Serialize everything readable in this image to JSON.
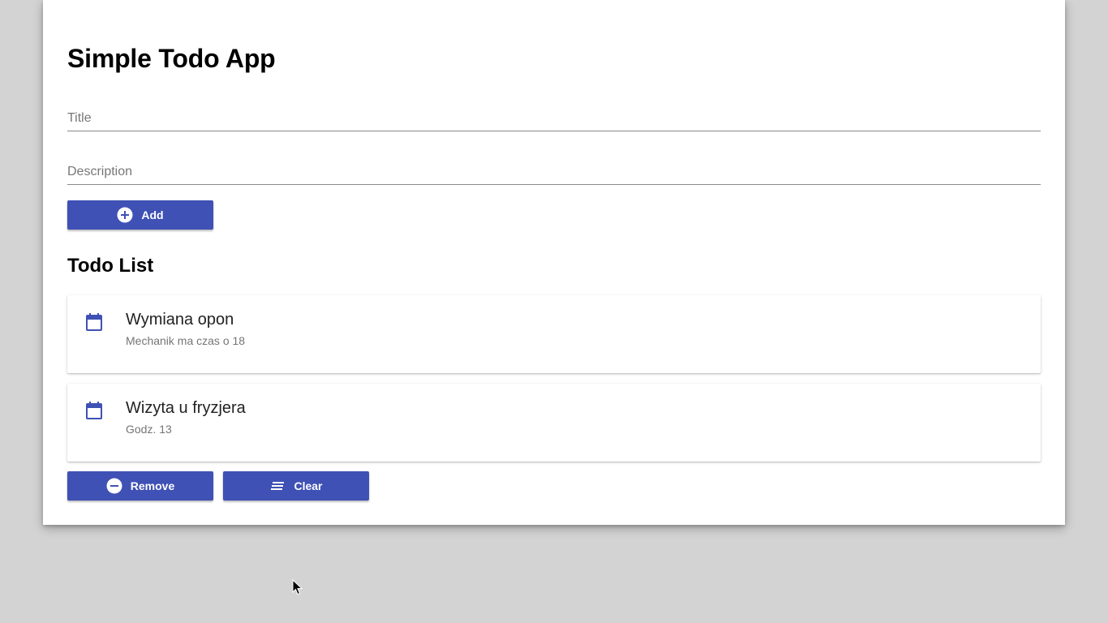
{
  "app": {
    "title": "Simple Todo App"
  },
  "form": {
    "title_placeholder": "Title",
    "title_value": "",
    "description_placeholder": "Description",
    "description_value": "",
    "add_label": "Add"
  },
  "list": {
    "heading": "Todo List",
    "items": [
      {
        "title": "Wymiana opon",
        "description": "Mechanik ma czas o 18",
        "icon": "calendar-icon"
      },
      {
        "title": "Wizyta u fryzjera",
        "description": "Godz. 13",
        "icon": "calendar-icon"
      }
    ]
  },
  "actions": {
    "remove_label": "Remove",
    "clear_label": "Clear"
  },
  "colors": {
    "primary": "#3f51b5",
    "background": "#d3d3d3"
  }
}
